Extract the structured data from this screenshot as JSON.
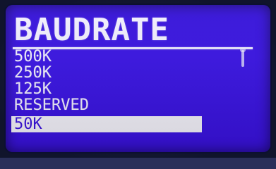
{
  "screen": {
    "title": "BAUDRATE",
    "options": [
      {
        "label": "500K",
        "selected": false
      },
      {
        "label": "250K",
        "selected": false
      },
      {
        "label": "125K",
        "selected": false
      },
      {
        "label": "RESERVED",
        "selected": false
      },
      {
        "label": "50K",
        "selected": true
      }
    ]
  },
  "colors": {
    "lcd_background": "#3a12e0",
    "text": "#f2f0ff",
    "selection_background": "#f4f2fb"
  }
}
